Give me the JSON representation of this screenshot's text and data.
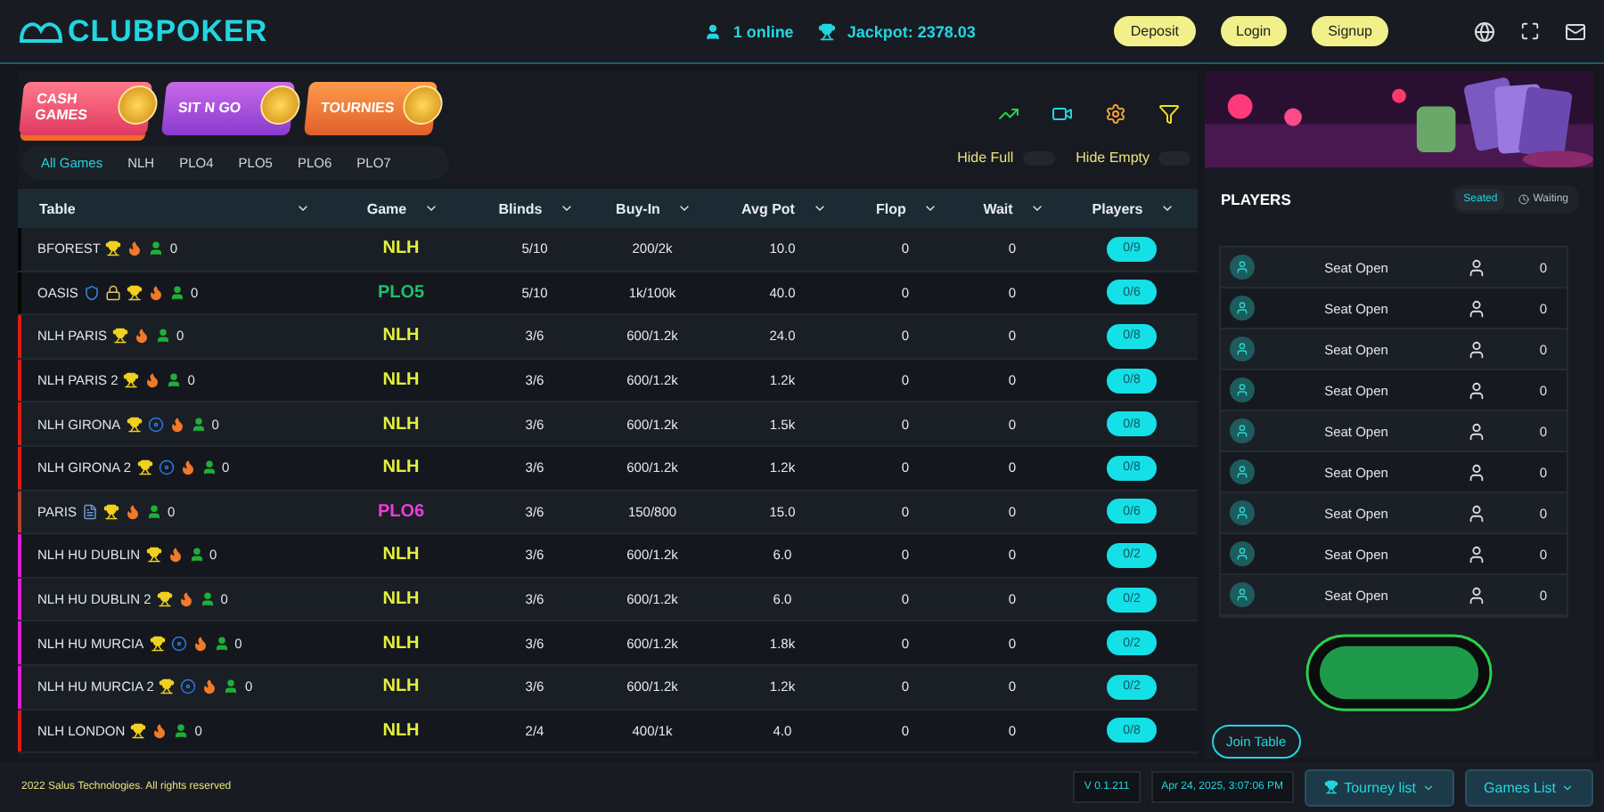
{
  "header": {
    "logo": "CLUBPOKER",
    "online": "1 online",
    "jackpot": "Jackpot: 2378.03",
    "buttons": [
      "Deposit",
      "Login",
      "Signup"
    ]
  },
  "game_types": [
    {
      "label": "CASH GAMES",
      "kind": "cash",
      "selected": true
    },
    {
      "label": "SIT N GO",
      "kind": "sitngo",
      "selected": false
    },
    {
      "label": "TOURNIES",
      "kind": "tournies",
      "selected": false
    }
  ],
  "filters": [
    {
      "label": "All Games",
      "selected": true
    },
    {
      "label": "NLH",
      "selected": false
    },
    {
      "label": "PLO4",
      "selected": false
    },
    {
      "label": "PLO5",
      "selected": false
    },
    {
      "label": "PLO6",
      "selected": false
    },
    {
      "label": "PLO7",
      "selected": false
    }
  ],
  "toggles": [
    {
      "label": "Hide Full",
      "on": false
    },
    {
      "label": "Hide Empty",
      "on": false
    }
  ],
  "table": {
    "columns": [
      "Table",
      "Game",
      "Blinds",
      "Buy-In",
      "Avg Pot",
      "Flop",
      "Wait",
      "Players"
    ],
    "rows": [
      {
        "name": "BFOREST",
        "color": "#050505",
        "badges": [
          {
            "kind": "trophy"
          },
          {
            "kind": "flame"
          },
          {
            "kind": "player"
          }
        ],
        "count": "0",
        "game": {
          "label": "NLH",
          "color": "#e3f03c"
        },
        "blinds": "5/10",
        "buyin": "200/2k",
        "avg_pot": "10.0",
        "flop": "0",
        "wait": "0",
        "players": "0/9"
      },
      {
        "name": "OASIS",
        "color": "#050505",
        "badges": [
          {
            "kind": "shield"
          },
          {
            "kind": "lock"
          },
          {
            "kind": "trophy"
          },
          {
            "kind": "flame"
          },
          {
            "kind": "player"
          }
        ],
        "count": "0",
        "game": {
          "label": "PLO5",
          "color": "#1ec06a"
        },
        "blinds": "5/10",
        "buyin": "1k/100k",
        "avg_pot": "40.0",
        "flop": "0",
        "wait": "0",
        "players": "0/6"
      },
      {
        "name": "NLH PARIS",
        "color": "#e01b12",
        "badges": [
          {
            "kind": "trophy"
          },
          {
            "kind": "flame"
          },
          {
            "kind": "player"
          }
        ],
        "count": "0",
        "game": {
          "label": "NLH",
          "color": "#e3f03c"
        },
        "blinds": "3/6",
        "buyin": "600/1.2k",
        "avg_pot": "24.0",
        "flop": "0",
        "wait": "0",
        "players": "0/8"
      },
      {
        "name": "NLH PARIS 2",
        "color": "#e01b12",
        "badges": [
          {
            "kind": "trophy"
          },
          {
            "kind": "flame"
          },
          {
            "kind": "player"
          }
        ],
        "count": "0",
        "game": {
          "label": "NLH",
          "color": "#e3f03c"
        },
        "blinds": "3/6",
        "buyin": "600/1.2k",
        "avg_pot": "1.2k",
        "flop": "0",
        "wait": "0",
        "players": "0/8"
      },
      {
        "name": "NLH GIRONA",
        "color": "#e01b12",
        "badges": [
          {
            "kind": "trophy"
          },
          {
            "kind": "ring"
          },
          {
            "kind": "flame"
          },
          {
            "kind": "player"
          }
        ],
        "count": "0",
        "game": {
          "label": "NLH",
          "color": "#e3f03c"
        },
        "blinds": "3/6",
        "buyin": "600/1.2k",
        "avg_pot": "1.5k",
        "flop": "0",
        "wait": "0",
        "players": "0/8"
      },
      {
        "name": "NLH GIRONA 2",
        "color": "#e01b12",
        "badges": [
          {
            "kind": "trophy"
          },
          {
            "kind": "ring"
          },
          {
            "kind": "flame"
          },
          {
            "kind": "player"
          }
        ],
        "count": "0",
        "game": {
          "label": "NLH",
          "color": "#e3f03c"
        },
        "blinds": "3/6",
        "buyin": "600/1.2k",
        "avg_pot": "1.2k",
        "flop": "0",
        "wait": "0",
        "players": "0/8"
      },
      {
        "name": "PARIS",
        "color": "#b8402a",
        "badges": [
          {
            "kind": "note"
          },
          {
            "kind": "trophy"
          },
          {
            "kind": "flame"
          },
          {
            "kind": "player"
          }
        ],
        "count": "0",
        "game": {
          "label": "PLO6",
          "color": "#f03cdc"
        },
        "blinds": "3/6",
        "buyin": "150/800",
        "avg_pot": "15.0",
        "flop": "0",
        "wait": "0",
        "players": "0/6"
      },
      {
        "name": "NLH HU DUBLIN",
        "color": "#e21ad8",
        "badges": [
          {
            "kind": "trophy"
          },
          {
            "kind": "flame"
          },
          {
            "kind": "player"
          }
        ],
        "count": "0",
        "game": {
          "label": "NLH",
          "color": "#e3f03c"
        },
        "blinds": "3/6",
        "buyin": "600/1.2k",
        "avg_pot": "6.0",
        "flop": "0",
        "wait": "0",
        "players": "0/2"
      },
      {
        "name": "NLH HU DUBLIN 2",
        "color": "#e21ad8",
        "badges": [
          {
            "kind": "trophy"
          },
          {
            "kind": "flame"
          },
          {
            "kind": "player"
          }
        ],
        "count": "0",
        "game": {
          "label": "NLH",
          "color": "#e3f03c"
        },
        "blinds": "3/6",
        "buyin": "600/1.2k",
        "avg_pot": "6.0",
        "flop": "0",
        "wait": "0",
        "players": "0/2"
      },
      {
        "name": "NLH HU MURCIA",
        "color": "#e21ad8",
        "badges": [
          {
            "kind": "trophy"
          },
          {
            "kind": "ring"
          },
          {
            "kind": "flame"
          },
          {
            "kind": "player"
          }
        ],
        "count": "0",
        "game": {
          "label": "NLH",
          "color": "#e3f03c"
        },
        "blinds": "3/6",
        "buyin": "600/1.2k",
        "avg_pot": "1.8k",
        "flop": "0",
        "wait": "0",
        "players": "0/2"
      },
      {
        "name": "NLH HU MURCIA 2",
        "color": "#e21ad8",
        "badges": [
          {
            "kind": "trophy"
          },
          {
            "kind": "ring"
          },
          {
            "kind": "flame"
          },
          {
            "kind": "player"
          }
        ],
        "count": "0",
        "game": {
          "label": "NLH",
          "color": "#e3f03c"
        },
        "blinds": "3/6",
        "buyin": "600/1.2k",
        "avg_pot": "1.2k",
        "flop": "0",
        "wait": "0",
        "players": "0/2"
      },
      {
        "name": "NLH LONDON",
        "color": "#e01b12",
        "badges": [
          {
            "kind": "trophy"
          },
          {
            "kind": "flame"
          },
          {
            "kind": "player"
          }
        ],
        "count": "0",
        "game": {
          "label": "NLH",
          "color": "#e3f03c"
        },
        "blinds": "2/4",
        "buyin": "400/1k",
        "avg_pot": "4.0",
        "flop": "0",
        "wait": "0",
        "players": "0/8"
      }
    ]
  },
  "players": {
    "title": "PLAYERS",
    "tabs": [
      {
        "label": "Seated",
        "selected": true
      },
      {
        "label": "Waiting",
        "selected": false
      }
    ],
    "seats": [
      {
        "label": "Seat Open",
        "value": "0"
      },
      {
        "label": "Seat Open",
        "value": "0"
      },
      {
        "label": "Seat Open",
        "value": "0"
      },
      {
        "label": "Seat Open",
        "value": "0"
      },
      {
        "label": "Seat Open",
        "value": "0"
      },
      {
        "label": "Seat Open",
        "value": "0"
      },
      {
        "label": "Seat Open",
        "value": "0"
      },
      {
        "label": "Seat Open",
        "value": "0"
      },
      {
        "label": "Seat Open",
        "value": "0"
      }
    ],
    "join": "Join Table"
  },
  "footer": {
    "copyright": "2022 Salus Technologies. All rights reserved",
    "version": "V 0.1.211",
    "datetime": "Apr 24, 2025, 3:07:06 PM",
    "buttons": [
      "Tourney list",
      "Games List"
    ]
  }
}
